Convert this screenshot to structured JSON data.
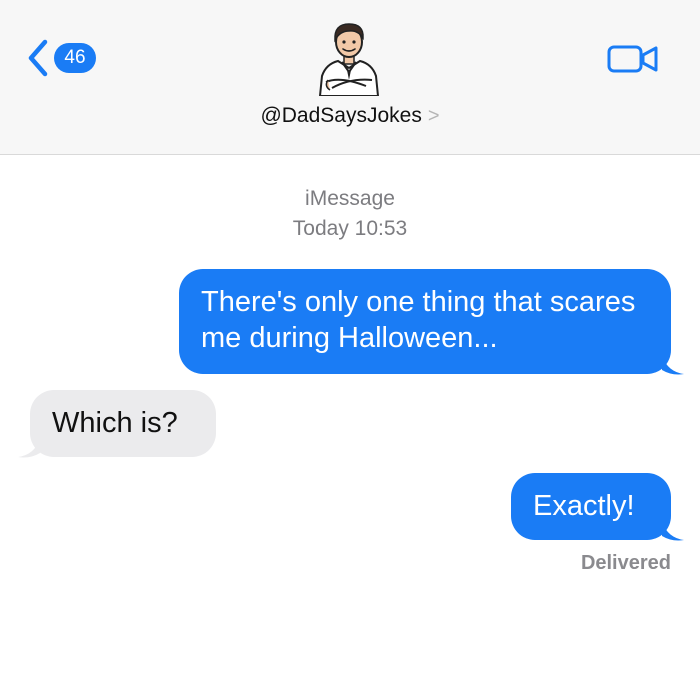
{
  "header": {
    "back_count": "46",
    "contact_name": "@DadSaysJokes",
    "contact_chevron": ">"
  },
  "icons": {
    "back": "chevron-left-icon",
    "video": "video-camera-icon",
    "avatar": "dad-avatar-icon"
  },
  "colors": {
    "accent": "#1a7cf5",
    "received_bubble": "#ebebed",
    "header_bg": "#f7f7f7",
    "meta_text": "#7c7c80"
  },
  "conversation": {
    "service": "iMessage",
    "timestamp": "Today 10:53",
    "messages": [
      {
        "direction": "sent",
        "text": "There's only one thing that scares me during Halloween..."
      },
      {
        "direction": "received",
        "text": "Which is?"
      },
      {
        "direction": "sent",
        "text": "Exactly!"
      }
    ],
    "status": "Delivered"
  }
}
